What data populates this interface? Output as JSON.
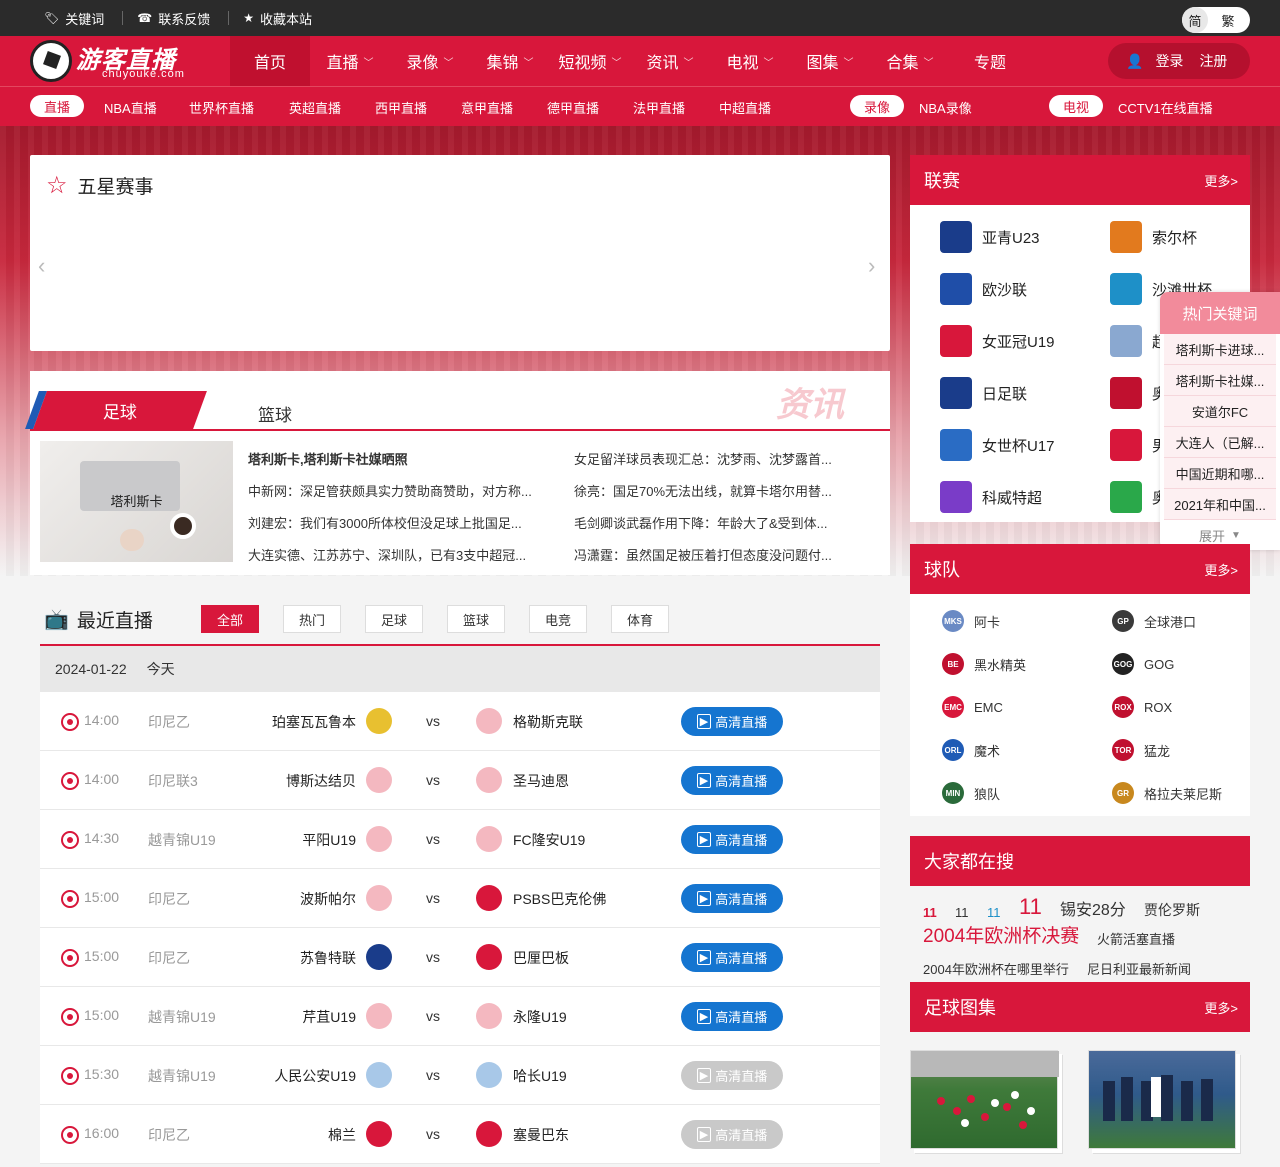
{
  "topbar": {
    "items": [
      {
        "icon": "tag-icon",
        "label": "关键词"
      },
      {
        "icon": "phone-icon",
        "label": "联系反馈"
      },
      {
        "icon": "star-icon",
        "label": "收藏本站"
      }
    ],
    "lang": {
      "simplified": "简",
      "traditional": "繁"
    }
  },
  "logo": {
    "title": "游客直播",
    "domain": "chuyouke.com"
  },
  "nav": {
    "items": [
      {
        "label": "首页",
        "dropdown": false
      },
      {
        "label": "直播",
        "dropdown": true
      },
      {
        "label": "录像",
        "dropdown": true
      },
      {
        "label": "集锦",
        "dropdown": true
      },
      {
        "label": "短视频",
        "dropdown": true
      },
      {
        "label": "资讯",
        "dropdown": true
      },
      {
        "label": "电视",
        "dropdown": true
      },
      {
        "label": "图集",
        "dropdown": true
      },
      {
        "label": "合集",
        "dropdown": true
      },
      {
        "label": "专题",
        "dropdown": false
      }
    ],
    "login": "登录",
    "register": "注册"
  },
  "subnav": {
    "live_pill": "直播",
    "live_links": [
      "NBA直播",
      "世界杯直播",
      "英超直播",
      "西甲直播",
      "意甲直播",
      "德甲直播",
      "法甲直播",
      "中超直播"
    ],
    "replay_pill": "录像",
    "replay_links": [
      "NBA录像"
    ],
    "tv_pill": "电视",
    "tv_links": [
      "CCTV1在线直播"
    ]
  },
  "fivestar": {
    "title": "五星赛事",
    "prev": "‹",
    "next": "›"
  },
  "news": {
    "tab_football": "足球",
    "tab_basketball": "篮球",
    "watermark": "资讯",
    "thumb_caption": "塔利斯卡",
    "left": [
      "塔利斯卡,塔利斯卡社媒晒照",
      "中新网：深足管获颇具实力赞助商赞助，对方称...",
      "刘建宏：我们有3000所体校但没足球上批国足...",
      "大连实德、江苏苏宁、深圳队，已有3支中超冠..."
    ],
    "right": [
      "女足留洋球员表现汇总：沈梦雨、沈梦露首...",
      "徐亮：国足70%无法出线，就算卡塔尔用替...",
      "毛剑卿谈武磊作用下降：年龄大了&受到体...",
      "冯潇霆：虽然国足被压着打但态度没问题付..."
    ]
  },
  "leagues": {
    "title": "联赛",
    "more": "更多>",
    "items": [
      {
        "name": "亚青U23",
        "color": "#1a3c8a"
      },
      {
        "name": "索尔杯",
        "color": "#e27a1e"
      },
      {
        "name": "欧沙联",
        "color": "#1f4ea8"
      },
      {
        "name": "沙滩世杯",
        "color": "#1e90c8"
      },
      {
        "name": "女亚冠U19",
        "color": "#d8173b"
      },
      {
        "name": "超级杯",
        "color": "#8aa8d0"
      },
      {
        "name": "日足联",
        "color": "#1a3c8a"
      },
      {
        "name": "奥运会",
        "color": "#c0102f"
      },
      {
        "name": "女世杯U17",
        "color": "#2a6cc4"
      },
      {
        "name": "男世杯",
        "color": "#d8173b"
      },
      {
        "name": "科威特超",
        "color": "#7a3cc8"
      },
      {
        "name": "奥运男足",
        "color": "#2aa84a"
      }
    ]
  },
  "hot_keywords": {
    "title": "热门关键词",
    "items": [
      "塔利斯卡进球...",
      "塔利斯卡社媒...",
      "安道尔FC",
      "大连人（已解...",
      "中国近期和哪...",
      "2021年和中国..."
    ],
    "expand": "展开"
  },
  "teams": {
    "title": "球队",
    "more": "更多>",
    "items": [
      {
        "name": "阿卡",
        "abbr": "MKS",
        "color": "#6a8ac4"
      },
      {
        "name": "全球港口",
        "abbr": "GP",
        "color": "#3a3a3a"
      },
      {
        "name": "黑水精英",
        "abbr": "BE",
        "color": "#c0102f"
      },
      {
        "name": "GOG",
        "abbr": "GOG",
        "color": "#222222"
      },
      {
        "name": "EMC",
        "abbr": "EMC",
        "color": "#d8173b"
      },
      {
        "name": "ROX",
        "abbr": "ROX",
        "color": "#c0102f"
      },
      {
        "name": "魔术",
        "abbr": "ORL",
        "color": "#1f5bb5"
      },
      {
        "name": "猛龙",
        "abbr": "TOR",
        "color": "#c0102f"
      },
      {
        "name": "狼队",
        "abbr": "MIN",
        "color": "#2a6a3a"
      },
      {
        "name": "格拉夫莱尼斯",
        "abbr": "GR",
        "color": "#c8881e"
      }
    ]
  },
  "search_all": {
    "title": "大家都在搜",
    "tags": [
      {
        "text": "11",
        "size": 13,
        "color": "#d8173b",
        "bold": true
      },
      {
        "text": "11",
        "size": 13,
        "color": "#333",
        "bold": false
      },
      {
        "text": "11",
        "size": 13,
        "color": "#1e90c8",
        "bold": false
      },
      {
        "text": "11",
        "size": 22,
        "color": "#d8173b",
        "bold": false
      },
      {
        "text": "锡安28分",
        "size": 16,
        "color": "#333",
        "bold": false
      },
      {
        "text": "贾伦罗斯",
        "size": 14,
        "color": "#333",
        "bold": false
      },
      {
        "text": "2004年欧洲杯决赛",
        "size": 19,
        "color": "#d8173b",
        "bold": false
      },
      {
        "text": "火箭活塞直播",
        "size": 13,
        "color": "#333",
        "bold": false
      },
      {
        "text": "2004年欧洲杯在哪里举行",
        "size": 13,
        "color": "#333",
        "bold": false
      },
      {
        "text": "尼日利亚最新新闻",
        "size": 13,
        "color": "#333",
        "bold": false
      }
    ]
  },
  "gallery": {
    "title": "足球图集",
    "more": "更多>"
  },
  "live": {
    "title": "最近直播",
    "filters": [
      "全部",
      "热门",
      "足球",
      "篮球",
      "电竞",
      "体育"
    ],
    "date": "2024-01-22",
    "day": "今天",
    "vs": "vs",
    "rows": [
      {
        "time": "14:00",
        "league": "印尼乙",
        "home": "珀塞瓦瓦鲁本",
        "away": "格勒斯克联",
        "btn": "高清直播",
        "active": true,
        "hcolor": "#e8c030",
        "acolor": "#f4b8c0"
      },
      {
        "time": "14:00",
        "league": "印尼联3",
        "home": "博斯达结贝",
        "away": "圣马迪恩",
        "btn": "高清直播",
        "active": true,
        "hcolor": "#f4b8c0",
        "acolor": "#f4b8c0"
      },
      {
        "time": "14:30",
        "league": "越青锦U19",
        "home": "平阳U19",
        "away": "FC隆安U19",
        "btn": "高清直播",
        "active": true,
        "hcolor": "#f4b8c0",
        "acolor": "#f4b8c0"
      },
      {
        "time": "15:00",
        "league": "印尼乙",
        "home": "波斯帕尔",
        "away": "PSBS巴克伦佛",
        "btn": "高清直播",
        "active": true,
        "hcolor": "#f4b8c0",
        "acolor": "#d8173b"
      },
      {
        "time": "15:00",
        "league": "印尼乙",
        "home": "苏鲁特联",
        "away": "巴厘巴板",
        "btn": "高清直播",
        "active": true,
        "hcolor": "#1a3c8a",
        "acolor": "#d8173b"
      },
      {
        "time": "15:00",
        "league": "越青锦U19",
        "home": "芹苴U19",
        "away": "永隆U19",
        "btn": "高清直播",
        "active": true,
        "hcolor": "#f4b8c0",
        "acolor": "#f4b8c0"
      },
      {
        "time": "15:30",
        "league": "越青锦U19",
        "home": "人民公安U19",
        "away": "哈长U19",
        "btn": "高清直播",
        "active": false,
        "hcolor": "#a8c8e8",
        "acolor": "#a8c8e8"
      },
      {
        "time": "16:00",
        "league": "印尼乙",
        "home": "棉兰",
        "away": "塞曼巴东",
        "btn": "高清直播",
        "active": false,
        "hcolor": "#d8173b",
        "acolor": "#d8173b"
      }
    ]
  }
}
